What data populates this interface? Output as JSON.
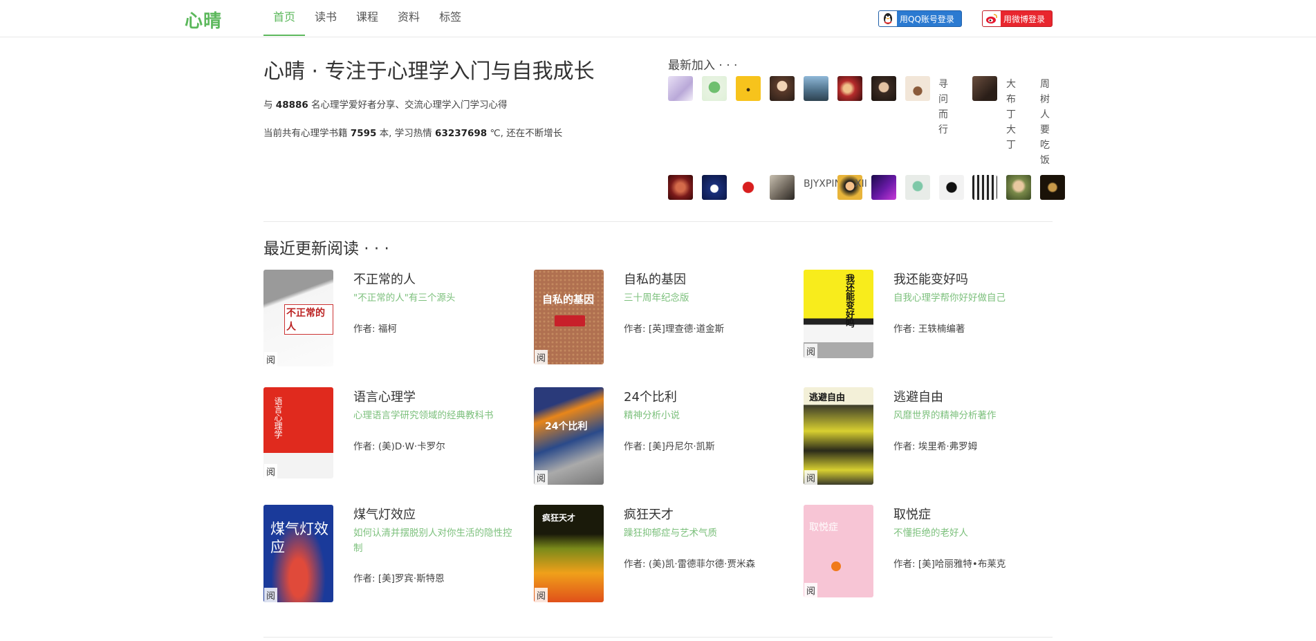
{
  "header": {
    "logo": "心晴",
    "nav": [
      "首页",
      "读书",
      "课程",
      "资料",
      "标签"
    ],
    "qq_login": "用QQ账号登录",
    "weibo_login": "用微博登录"
  },
  "hero": {
    "title": "心晴 · 专注于心理学入门与自我成长",
    "line1_pre": "与 ",
    "member_count": "48886",
    "line1_post": " 名心理学爱好者分享、交流心理学入门学习心得",
    "line2_pre": "当前共有心理学书籍 ",
    "book_count": "7595",
    "line2_mid": " 本, 学习热情 ",
    "heat": "63237698",
    "line2_post": " ℃, 还在不断增长"
  },
  "newest": {
    "title": "最新加入 · · ·",
    "text_names": [
      "寻问而行",
      "大布丁大丁",
      "周树人要吃饭",
      "BJYXPIN",
      "XII"
    ]
  },
  "recent": {
    "title": "最近更新阅读 · · ·",
    "read_badge": "阅",
    "author_prefix": "作者: ",
    "books": [
      {
        "title": "不正常的人",
        "subtitle": "\"不正常的人\"有三个源头",
        "author": "福柯",
        "cover_text": "不正常的人"
      },
      {
        "title": "自私的基因",
        "subtitle": "三十周年纪念版",
        "author": "[英]理查德·道金斯",
        "cover_text": "自私的基因"
      },
      {
        "title": "我还能变好吗",
        "subtitle": "自我心理学帮你好好做自己",
        "author": "王轶楠编著",
        "cover_text": "我还能变好吗"
      },
      {
        "title": "语言心理学",
        "subtitle": "心理语言学研究领域的经典教科书",
        "author": "(美)D·W·卡罗尔",
        "cover_text": "语言心理学"
      },
      {
        "title": "24个比利",
        "subtitle": "精神分析小说",
        "author": "[美]丹尼尔·凯斯",
        "cover_text": "24个比利"
      },
      {
        "title": "逃避自由",
        "subtitle": "风靡世界的精神分析著作",
        "author": "埃里希·弗罗姆",
        "cover_text": "逃避自由"
      },
      {
        "title": "煤气灯效应",
        "subtitle": "如何认清并摆脱别人对你生活的隐性控制",
        "author": "[美]罗宾·斯特恩",
        "cover_text": "煤气灯效应"
      },
      {
        "title": "疯狂天才",
        "subtitle": "躁狂抑郁症与艺术气质",
        "author": "(美)凯·雷德菲尔德·贾米森",
        "cover_text": "疯狂天才"
      },
      {
        "title": "取悦症",
        "subtitle": "不懂拒绝的老好人",
        "author": "[美]哈丽雅特•布莱克",
        "cover_text": "取悦症"
      }
    ]
  },
  "colors": {
    "brand_green": "#5cb85c",
    "subtitle_green": "#7cc07c",
    "qq_blue": "#2b7ad1",
    "weibo_red": "#e8262e"
  }
}
